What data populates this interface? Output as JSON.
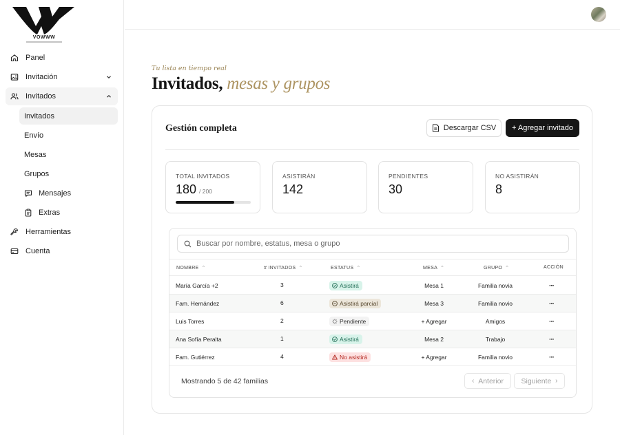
{
  "brand": {
    "logo_text": "VOWWW"
  },
  "sidebar": {
    "items": [
      {
        "label": "Panel",
        "icon": "home-icon"
      },
      {
        "label": "Invitación",
        "icon": "image-icon"
      },
      {
        "label": "Invitados",
        "icon": "users-icon"
      },
      {
        "label": "Herramientas",
        "icon": "wrench-icon"
      },
      {
        "label": "Cuenta",
        "icon": "card-icon"
      }
    ],
    "subitems": [
      {
        "label": "Invitados"
      },
      {
        "label": "Envío"
      },
      {
        "label": "Mesas"
      },
      {
        "label": "Grupos"
      },
      {
        "label": "Mensajes",
        "icon": "message-icon"
      },
      {
        "label": "Extras",
        "icon": "clipboard-icon"
      }
    ]
  },
  "header": {
    "eyebrow": "Tu lista en tiempo real",
    "title_main": "Invitados,",
    "title_accent": "mesas y grupos"
  },
  "card": {
    "title": "Gestión completa",
    "csv_label": "Descargar CSV",
    "add_label": "+ Agregar invitado"
  },
  "stats": [
    {
      "label": "TOTAL INVITADOS",
      "value": "180",
      "of": "/ 200",
      "progress": 0.78
    },
    {
      "label": "ASISTIRÁN",
      "value": "142"
    },
    {
      "label": "PENDIENTES",
      "value": "30"
    },
    {
      "label": "NO ASISTIRÁN",
      "value": "8"
    }
  ],
  "search": {
    "placeholder": "Buscar por nombre, estatus, mesa o grupo"
  },
  "table": {
    "columns": [
      "NOMBRE",
      "# INVITADOS",
      "ESTATUS",
      "MESA",
      "GRUPO",
      "ACCIÓN"
    ],
    "rows": [
      {
        "nombre": "María García +2",
        "invitados": "3",
        "estatus": "Asistirá",
        "status_kind": "confirmed",
        "mesa": "Mesa 1",
        "grupo": "Familia novia",
        "accion": "···"
      },
      {
        "nombre": "Fam. Hernández",
        "invitados": "6",
        "estatus": "Asistirá parcial",
        "status_kind": "partial",
        "mesa": "Mesa 3",
        "grupo": "Familia novio",
        "accion": "···"
      },
      {
        "nombre": "Luis Torres",
        "invitados": "2",
        "estatus": "Pendiente",
        "status_kind": "pending",
        "mesa": "+ Agregar",
        "grupo": "Amigos",
        "accion": "···"
      },
      {
        "nombre": "Ana Sofía Peralta",
        "invitados": "1",
        "estatus": "Asistirá",
        "status_kind": "confirmed",
        "mesa": "Mesa 2",
        "grupo": "Trabajo",
        "accion": "···"
      },
      {
        "nombre": "Fam. Gutiérrez",
        "invitados": "4",
        "estatus": "No asistirá",
        "status_kind": "declined",
        "mesa": "+ Agregar",
        "grupo": "Familia novio",
        "accion": "···"
      }
    ]
  },
  "pagination": {
    "summary": "Mostrando 5 de 42 familias",
    "prev": "Anterior",
    "next": "Siguiente"
  },
  "colors": {
    "accent": "#ad9462",
    "primary_button": "#161616",
    "confirmed": "#d8f3ea",
    "partial": "#ece6da",
    "declined": "#fde1e1"
  }
}
